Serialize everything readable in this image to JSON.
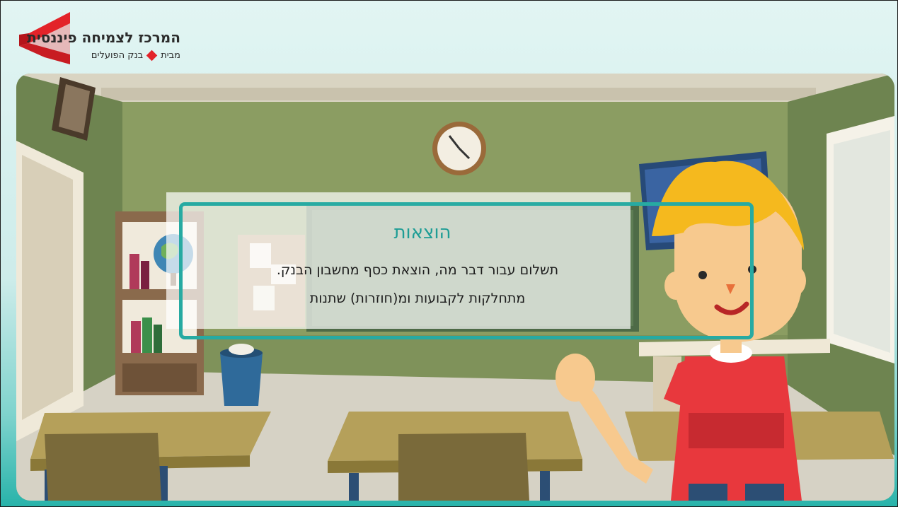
{
  "brand": {
    "title": "המרכז לצמיחה פיננסית",
    "subtitle_prefix": "מבית",
    "subtitle_bank": "בנק הפועלים",
    "logo_color": "#e32329"
  },
  "card": {
    "title": "הוצאות",
    "line1": "תשלום עבור דבר מה, הוצאת כסף מחשבון הבנק.",
    "line2": "מתחלקות לקבועות ומ(חוזרות) שתנות",
    "accent_color": "#27aaa2"
  },
  "scene": {
    "description_icon": "classroom-illustration",
    "character_icon": "waving-boy-icon",
    "clock_icon": "wall-clock-icon",
    "globe_icon": "globe-icon",
    "trash_icon": "trash-bin-icon"
  }
}
